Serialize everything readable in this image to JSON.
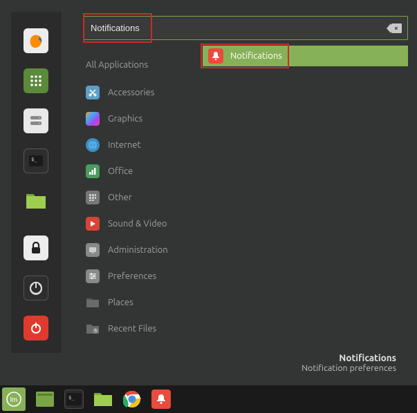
{
  "search": {
    "value": "Notifications",
    "placeholder": ""
  },
  "categories": [
    {
      "label": "All Applications",
      "icon": "all-apps-icon"
    },
    {
      "label": "Accessories",
      "icon": "scissors-icon"
    },
    {
      "label": "Graphics",
      "icon": "graphics-icon"
    },
    {
      "label": "Internet",
      "icon": "globe-icon"
    },
    {
      "label": "Office",
      "icon": "office-icon"
    },
    {
      "label": "Other",
      "icon": "grid-icon"
    },
    {
      "label": "Sound & Video",
      "icon": "play-icon"
    },
    {
      "label": "Administration",
      "icon": "admin-icon"
    },
    {
      "label": "Preferences",
      "icon": "preferences-icon"
    },
    {
      "label": "Places",
      "icon": "folder-icon"
    },
    {
      "label": "Recent Files",
      "icon": "recent-icon"
    }
  ],
  "result": {
    "label": "Notifications",
    "icon": "bell-icon"
  },
  "tooltip": {
    "title": "Notifications",
    "subtitle": "Notification preferences"
  },
  "favorites": [
    {
      "name": "firefox-icon"
    },
    {
      "name": "apps-icon"
    },
    {
      "name": "disks-icon"
    },
    {
      "name": "terminal-icon"
    },
    {
      "name": "files-icon"
    }
  ],
  "favorites_bottom": [
    {
      "name": "lock-icon"
    },
    {
      "name": "logout-icon"
    },
    {
      "name": "power-icon"
    }
  ],
  "taskbar": [
    {
      "name": "start-icon"
    },
    {
      "name": "show-desktop-icon"
    },
    {
      "name": "terminal-icon"
    },
    {
      "name": "files-icon"
    },
    {
      "name": "chrome-icon"
    },
    {
      "name": "notifications-icon"
    }
  ]
}
